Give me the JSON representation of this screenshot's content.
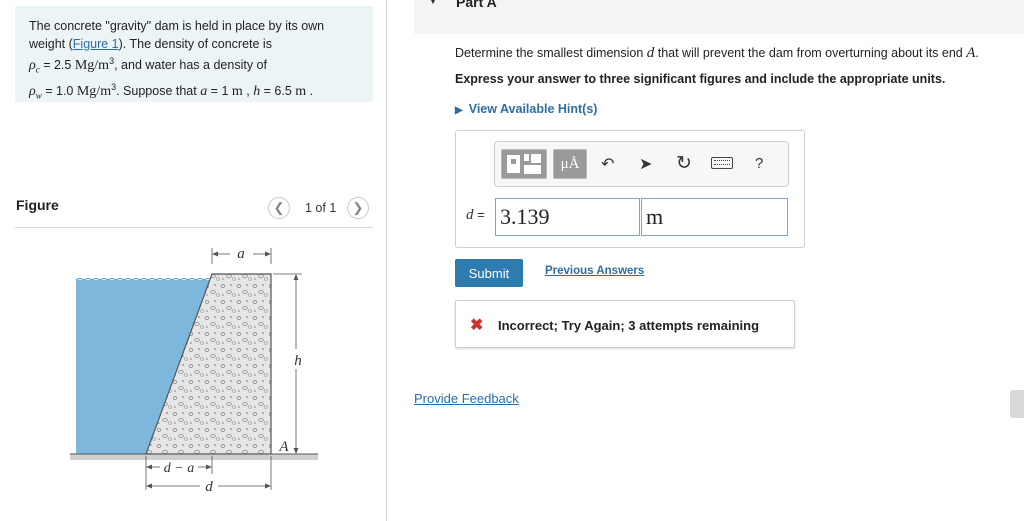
{
  "problem": {
    "intro": "The concrete \"gravity\" dam is held in place by its own weight (",
    "figure_link": "Figure 1",
    "intro_end": "). The density of concrete is",
    "rho_c_sym": "ρ",
    "rho_c_sub": "c",
    "rho_c_val": " = 2.5 ",
    "rho_c_unit": "Mg/m",
    "rho_c_tail": ", and water has a density of",
    "rho_w_sym": "ρ",
    "rho_w_sub": "w",
    "rho_w_val": " = 1.0 ",
    "rho_w_unit": "Mg/m",
    "rho_w_tail": ". Suppose that ",
    "a_sym": "a",
    "a_val": " = 1  ",
    "a_unit": "m",
    "sep": " , ",
    "h_sym": "h",
    "h_val": " = 6.5  ",
    "h_unit": "m",
    "end": " ."
  },
  "figure": {
    "title": "Figure",
    "pager": "1 of 1",
    "prev_icon": "chevron-left-icon",
    "next_icon": "chevron-right-icon",
    "labels": {
      "a_top": "a",
      "h": "h",
      "A": "A",
      "d_a": "d − a",
      "d": "d"
    }
  },
  "part": {
    "title": "Part A",
    "caret_icon": "caret-down-icon"
  },
  "question": {
    "text_before": "Determine the smallest dimension ",
    "d_sym": "d",
    "text_after": " that will prevent the dam from overturning about its end ",
    "A_sym": "A",
    "period": ".",
    "instruction": "Express your answer to three significant figures and include the appropriate units.",
    "hint": "View Available Hint(s)"
  },
  "toolbar": {
    "template_icon": "templates-icon",
    "units_label": "μÅ",
    "undo_icon": "undo-icon",
    "redo_icon": "redo-icon",
    "reset_icon": "reset-icon",
    "keyboard_icon": "keyboard-icon",
    "help_label": "?"
  },
  "answer": {
    "label_sym": "d",
    "label_eq": " =",
    "value": "3.139",
    "unit": "m"
  },
  "actions": {
    "submit": "Submit",
    "previous": "Previous Answers"
  },
  "feedback": {
    "icon": "x-icon",
    "mark": "✖",
    "text": "Incorrect; Try Again; 3 attempts remaining"
  },
  "footer": {
    "provide_feedback": "Provide Feedback"
  },
  "colors": {
    "accent": "#2e6da4",
    "submit_bg": "#2e7bb0",
    "error": "#d0312d",
    "water": "#7db8dc",
    "problem_bg": "#edf4f7"
  }
}
